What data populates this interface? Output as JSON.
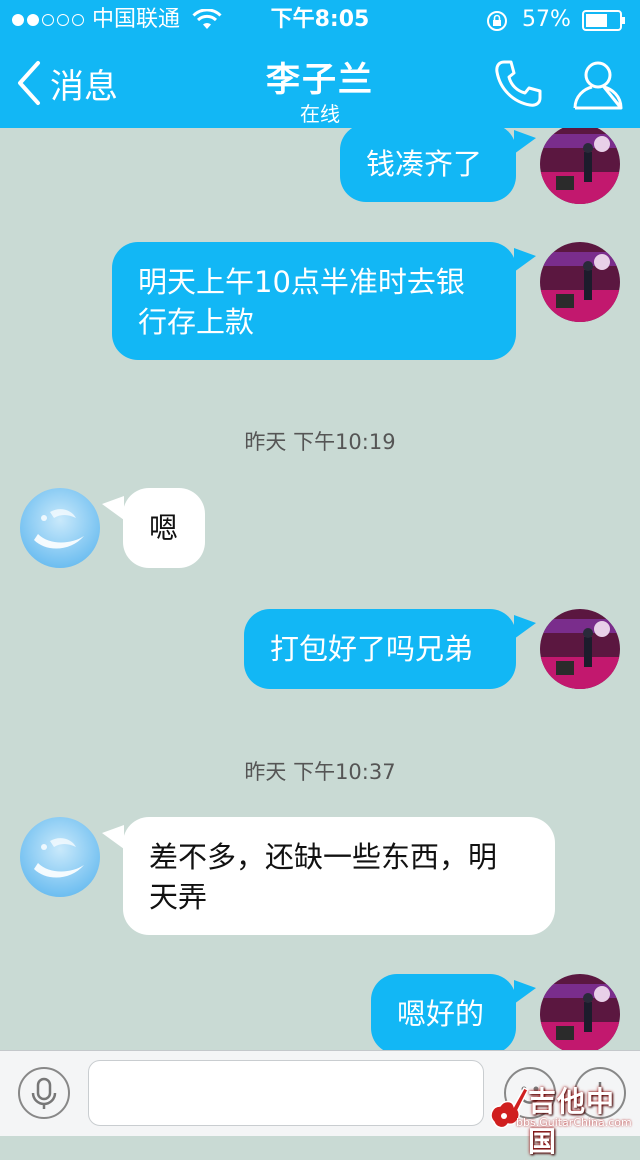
{
  "status": {
    "carrier": "中国联通",
    "time": "下午8:05",
    "battery": "57%"
  },
  "nav": {
    "back_label": "消息",
    "title": "李子兰",
    "subtitle": "在线"
  },
  "messages": {
    "m1": "钱凑齐了",
    "m2": "明天上午10点半准时去银\n行存上款",
    "ts1": "昨天  下午10:19",
    "m3": "嗯",
    "m4": "打包好了吗兄弟",
    "ts2": "昨天  下午10:37",
    "m5": "差不多，还缺一些东西，明\n天弄",
    "m6": "嗯好的"
  },
  "input": {
    "value": ""
  },
  "watermark": {
    "title": "吉他中国",
    "subtitle": "bbs.GuitarChina.com"
  },
  "colors": {
    "accent": "#12b7f5",
    "chat_background": "#c9dad4"
  },
  "icons": {
    "back": "chevron-left-icon",
    "call": "phone-icon",
    "profile": "person-icon",
    "mic": "microphone-icon",
    "emoji": "smile-icon",
    "plus": "plus-icon"
  }
}
